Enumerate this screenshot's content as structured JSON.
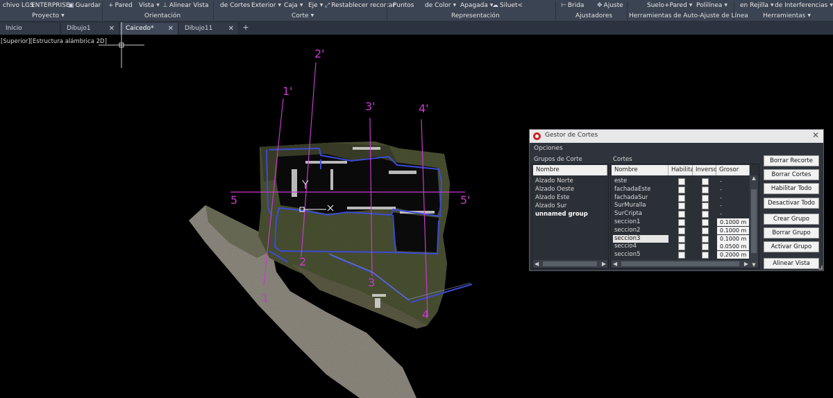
{
  "ribbon": {
    "items": [
      {
        "name": "archivo-lgs",
        "label": "chivo LGS"
      },
      {
        "name": "enterprise",
        "label": "ENTERPRISE"
      },
      {
        "name": "guardar",
        "label": "Guardar"
      },
      {
        "name": "pared",
        "label": "Pared"
      },
      {
        "name": "vista",
        "label": "Vista"
      },
      {
        "name": "alinear-vista",
        "label": "Alinear Vista"
      },
      {
        "name": "de-cortes",
        "label": "de Cortes"
      },
      {
        "name": "exterior",
        "label": "Exterior"
      },
      {
        "name": "caja",
        "label": "Caja"
      },
      {
        "name": "eje",
        "label": "Eje"
      },
      {
        "name": "restablecer-recortar",
        "label": "Restablecer recortar"
      },
      {
        "name": "puntos",
        "label": "Puntos"
      },
      {
        "name": "de-color",
        "label": "de Color"
      },
      {
        "name": "apagada",
        "label": "Apagada"
      },
      {
        "name": "siluet",
        "label": "Siluet<"
      },
      {
        "name": "brida",
        "label": "Brida"
      },
      {
        "name": "ajuste",
        "label": "Ajuste"
      },
      {
        "name": "suelo-pared",
        "label": "Suelo+Pared"
      },
      {
        "name": "polilinea",
        "label": "Polilínea"
      },
      {
        "name": "en-rejilla",
        "label": "en Rejilla"
      },
      {
        "name": "de-interferencias",
        "label": "de Interferencias"
      }
    ],
    "groups": {
      "proyecto": "Proyecto",
      "orientacion": "Orientación",
      "corte": "Corte",
      "representacion": "Representación",
      "ajustadores": "Ajustadores",
      "auto_ajuste": "Herramientas de Auto-Ajuste de Línea",
      "herramientas": "Herramientas"
    }
  },
  "tabs": [
    {
      "label": "Inicio",
      "closable": false,
      "active": false
    },
    {
      "label": "Dibujo1",
      "closable": true,
      "active": false
    },
    {
      "label": "Caicedo*",
      "closable": true,
      "active": true
    },
    {
      "label": "Dibujo11",
      "closable": true,
      "active": false
    }
  ],
  "tab_close_glyph": "✕",
  "tab_add_glyph": "+",
  "viewport": {
    "label": "[Superior][Estructura alámbrica 2D]",
    "section_labels": {
      "s1": "1",
      "s1p": "1'",
      "s2": "2",
      "s2p": "2'",
      "s3": "3",
      "s3p": "3'",
      "s4": "4",
      "s4p": "4'",
      "s5": "5",
      "s5p": "5'"
    },
    "colors": {
      "section_line": "#c83ad0",
      "cut_outline": "#3d4bd6"
    }
  },
  "dialog": {
    "title": "Gestor de Cortes",
    "close_glyph": "✕",
    "menu": "Opciones",
    "groups_title": "Grupos de Corte",
    "groups_header": "Nombre",
    "groups": [
      {
        "label": "Alzado Norte",
        "bold": false
      },
      {
        "label": "Alzado Oeste",
        "bold": false
      },
      {
        "label": "Alzado Este",
        "bold": false
      },
      {
        "label": "Alzado Sur",
        "bold": false
      },
      {
        "label": "unnamed group",
        "bold": true
      }
    ],
    "cuts_title": "Cortes",
    "cuts_headers": {
      "nombre": "Nombre",
      "habilitar": "Habilitar",
      "inverso": "Inverso",
      "grosor": "Grosor"
    },
    "cuts": [
      {
        "name": "este",
        "grosor": "-",
        "selected": false
      },
      {
        "name": "fachadaEste",
        "grosor": "-",
        "selected": false
      },
      {
        "name": "fachadaSur",
        "grosor": "-",
        "selected": false
      },
      {
        "name": "SurMuralla",
        "grosor": "-",
        "selected": false
      },
      {
        "name": "SurCripta",
        "grosor": "-",
        "selected": false
      },
      {
        "name": "seccion1",
        "grosor": "0.1000 m",
        "selected": false
      },
      {
        "name": "seccion2",
        "grosor": "0.1000 m",
        "selected": false
      },
      {
        "name": "seccion3",
        "grosor": "0.1000 m",
        "selected": true
      },
      {
        "name": "seccio4",
        "grosor": "0.0500 m",
        "selected": false
      },
      {
        "name": "seccion5",
        "grosor": "0.2000 m",
        "selected": false
      }
    ],
    "buttons": {
      "borrar_recorte": "Borrar Recorte",
      "borrar_cortes": "Borrar Cortes",
      "habilitar_todo": "Habilitar Todo",
      "desactivar_todo": "Desactivar Todo",
      "crear_grupo": "Crear Grupo",
      "borrar_grupo": "Borrar Grupo",
      "activar_grupo": "Activar Grupo",
      "alinear_vista": "Alinear Vista"
    }
  }
}
